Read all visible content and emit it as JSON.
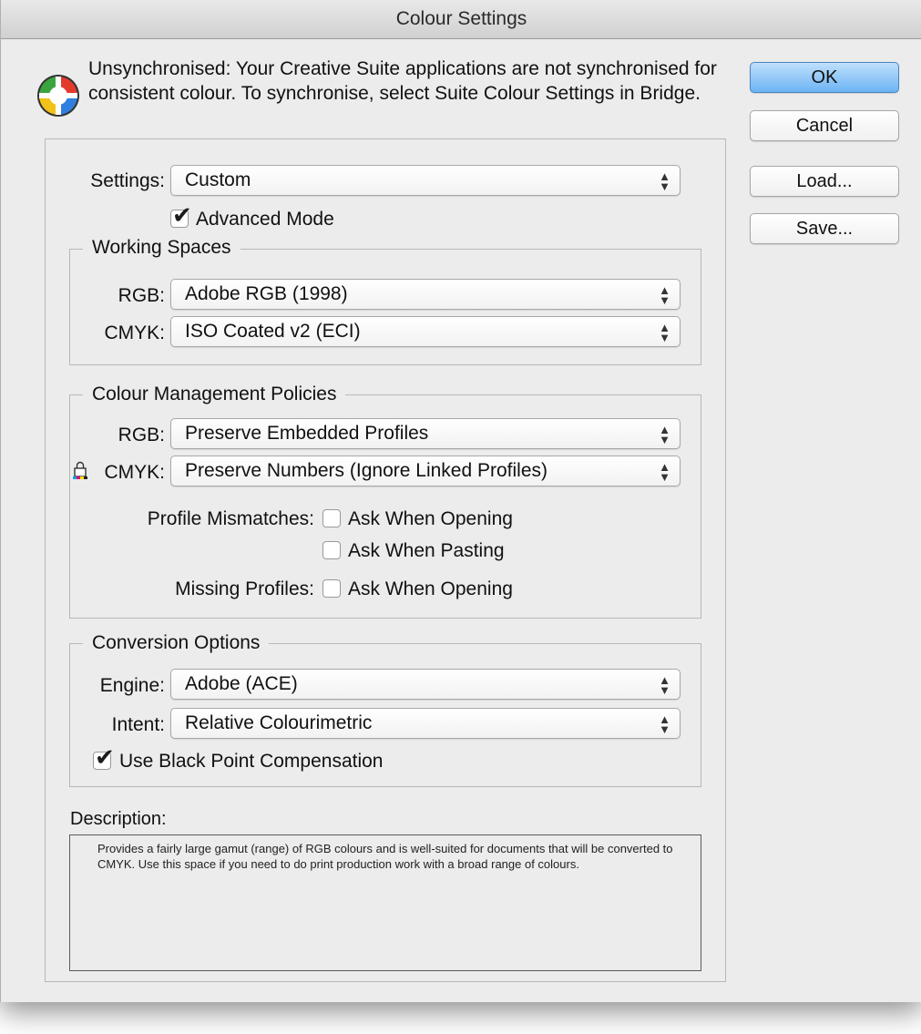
{
  "window": {
    "title": "Colour Settings"
  },
  "sync": {
    "icon": "color-wheel-icon",
    "message": "Unsynchronised: Your Creative Suite applications are not synchronised for consistent colour. To synchronise, select Suite Colour Settings in Bridge."
  },
  "buttons": {
    "ok": "OK",
    "cancel": "Cancel",
    "load": "Load...",
    "save": "Save..."
  },
  "settings": {
    "label": "Settings:",
    "value": "Custom",
    "advanced_mode_label": "Advanced Mode",
    "advanced_mode_checked": true
  },
  "working_spaces": {
    "legend": "Working Spaces",
    "rgb_label": "RGB:",
    "rgb_value": "Adobe RGB (1998)",
    "cmyk_label": "CMYK:",
    "cmyk_value": "ISO Coated v2 (ECI)"
  },
  "policies": {
    "legend": "Colour Management Policies",
    "rgb_label": "RGB:",
    "rgb_value": "Preserve Embedded Profiles",
    "cmyk_label": "CMYK:",
    "cmyk_icon": "lock-icon",
    "cmyk_value": "Preserve Numbers (Ignore Linked Profiles)",
    "profile_mismatches_label": "Profile Mismatches:",
    "ask_when_opening": "Ask When Opening",
    "ask_when_pasting": "Ask When Pasting",
    "missing_profiles_label": "Missing Profiles:",
    "missing_ask_when_opening": "Ask When Opening",
    "mismatch_opening_checked": false,
    "mismatch_pasting_checked": false,
    "missing_opening_checked": false
  },
  "conversion": {
    "legend": "Conversion Options",
    "engine_label": "Engine:",
    "engine_value": "Adobe (ACE)",
    "intent_label": "Intent:",
    "intent_value": "Relative Colourimetric",
    "bpc_label": "Use Black Point Compensation",
    "bpc_checked": true
  },
  "description": {
    "label": "Description:",
    "text": "Provides a fairly large gamut (range) of RGB colours and is well-suited for documents that will be converted to CMYK. Use this space if you need to do print production work with a broad range of colours."
  },
  "colors": {
    "window_bg": "#ececec",
    "default_button": "#6cb4f4"
  }
}
